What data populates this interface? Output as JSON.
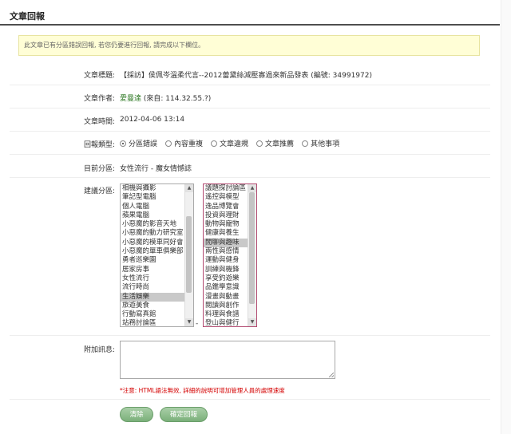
{
  "page": {
    "title": "文章回報"
  },
  "notice": {
    "text": "此文章已有分區錯誤回報, 若您仍要進行回報, 請完成以下欄位。"
  },
  "fields": {
    "article_title": {
      "label": "文章標題:",
      "value": "【採訪】侯佩岑溫柔代言--2012蕾黛絲減壓寡過來新品發表 (編號: 34991972)"
    },
    "article_author": {
      "label": "文章作者:",
      "author": "愛曼達",
      "source": " (來自: 114.32.55.?)"
    },
    "article_time": {
      "label": "文章時間:",
      "value": "2012-04-06 13:14"
    },
    "report_type": {
      "label": "回報類型:",
      "options": [
        "分區錯誤",
        "內容重複",
        "文章違規",
        "文章推薦",
        "其他事項"
      ],
      "selected": "分區錯誤"
    },
    "current_section": {
      "label": "目前分區:",
      "value": "女性流行 - 魔女情憾誌"
    },
    "suggested_section": {
      "label": "建議分區:",
      "left_options": [
        "相機與攝影",
        "筆記型電腦",
        "個人電腦",
        "蘋果電腦",
        "小惡魔的影音天地",
        "小惡魔的動力研究室",
        "小惡魔的模車同好會",
        "小惡魔的單車俱樂部",
        "勇者巡樂園",
        "居家房事",
        "女性流行",
        "流行時尚",
        "生活娛樂",
        "旅遊美食",
        "行動寫真館",
        "站務討論區"
      ],
      "left_selected": "生活娛樂",
      "right_options": [
        "議題探討論區",
        "遙控與模型",
        "逸品博覽會",
        "投資與理財",
        "動物與寵物",
        "健康與養生",
        "閒聊與趣味",
        "兩性與感情",
        "運動與健身",
        "訓練與機鋒",
        "享受釣遊樂",
        "品鑑學意識",
        "漫畫與動畫",
        "閱讀與創作",
        "料理與食譜",
        "登山與健行"
      ],
      "right_selected": "閒聊與趣味",
      "separator": "-"
    },
    "extra_message": {
      "label": "附加訊息:",
      "value": ""
    }
  },
  "note": "*注意: HTML語法無效, 詳細的說明可增加管理人員的處理速度",
  "buttons": {
    "clear": "清除",
    "confirm": "確定回報"
  },
  "colors": {
    "button_green": "#7bb07a",
    "notice_bg": "#fffed6",
    "author_green": "#2f7a25",
    "note_red": "#d40000",
    "right_list_border": "#b24a70"
  }
}
